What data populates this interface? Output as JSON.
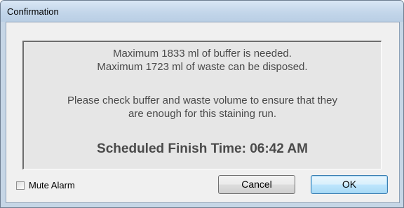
{
  "window": {
    "title": "Confirmation"
  },
  "message": {
    "line1": "Maximum 1833 ml of buffer is needed.",
    "line2": "Maximum 1723 ml of waste can be disposed.",
    "line3": "Please check buffer and waste volume to ensure that they",
    "line4": "are enough for this staining run.",
    "finish_time": "Scheduled Finish Time: 06:42 AM"
  },
  "controls": {
    "mute_label": "Mute Alarm",
    "mute_checked": false,
    "cancel_label": "Cancel",
    "ok_label": "OK"
  }
}
